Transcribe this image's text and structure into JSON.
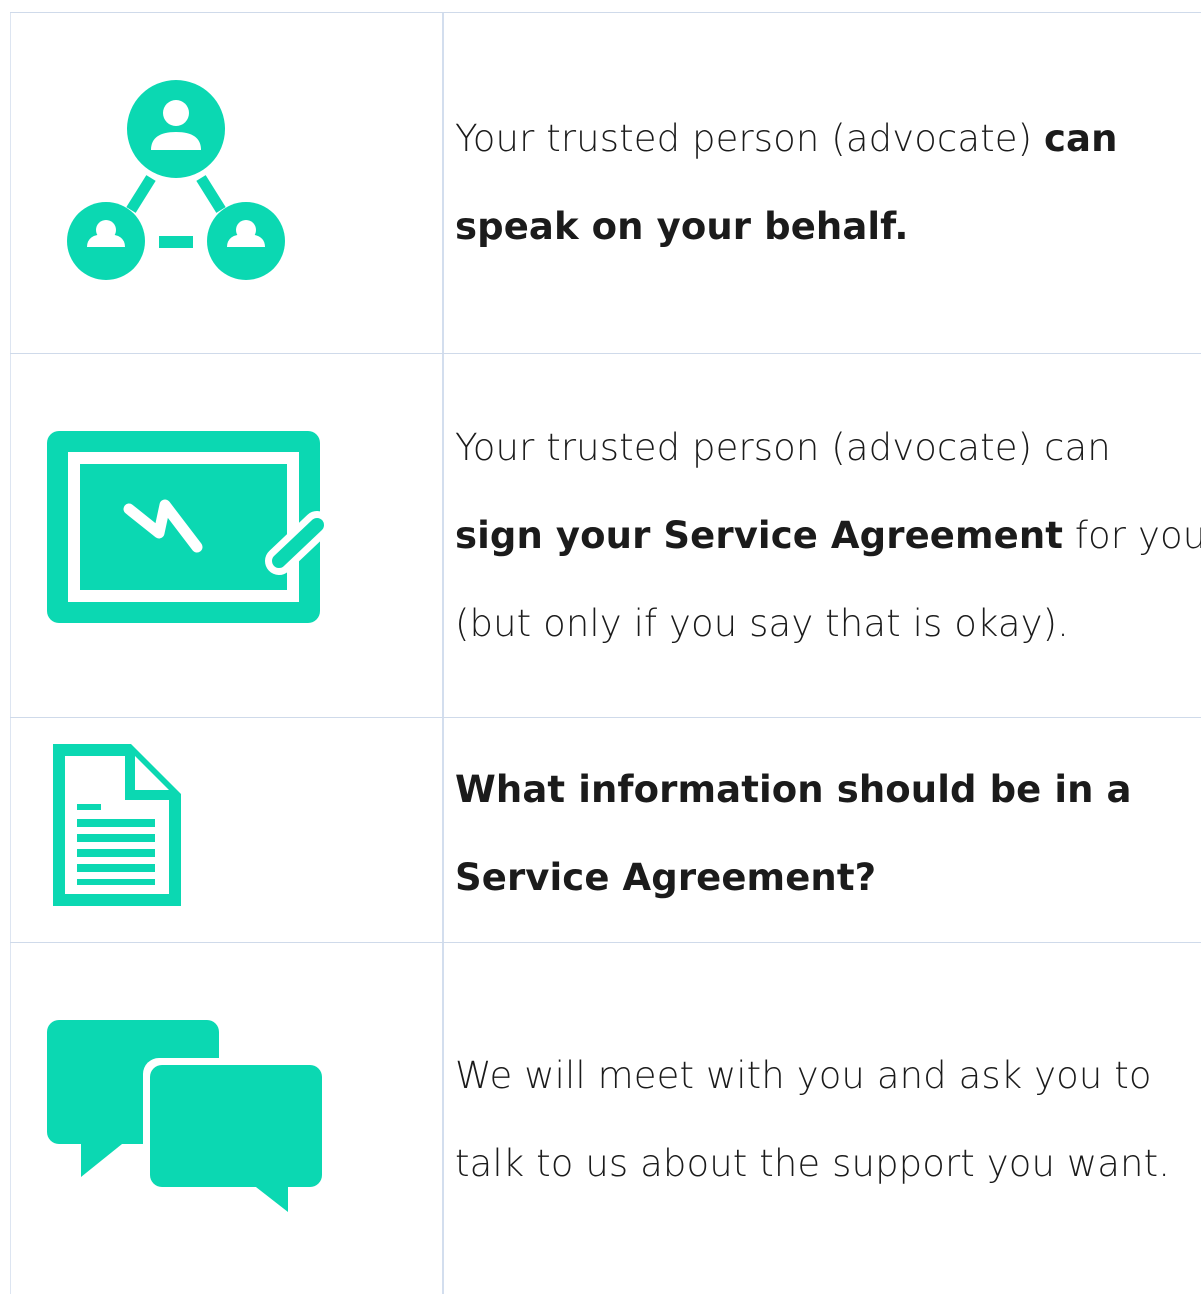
{
  "brand_color": "#0bd8b2",
  "rows": [
    {
      "icon": "people-network-icon",
      "lines": [
        {
          "a": "Your trusted person (advocate) ",
          "b": "can"
        },
        {
          "a": "",
          "b": "speak on your behalf."
        }
      ]
    },
    {
      "icon": "signature-pad-icon",
      "lines": [
        {
          "a": "Your trusted person (advocate) can"
        },
        {
          "b": "sign your Service Agreement",
          "c": " for you"
        },
        {
          "a": "(but only if you say that is okay)."
        }
      ]
    },
    {
      "icon": "document-icon",
      "lines": [
        {
          "b": "What information should be in a"
        },
        {
          "b": "Service Agreement?"
        }
      ]
    },
    {
      "icon": "speech-bubbles-icon",
      "lines": [
        {
          "a": "We will meet with you and ask you to"
        },
        {
          "a": "talk to us about the support you want."
        }
      ]
    }
  ]
}
